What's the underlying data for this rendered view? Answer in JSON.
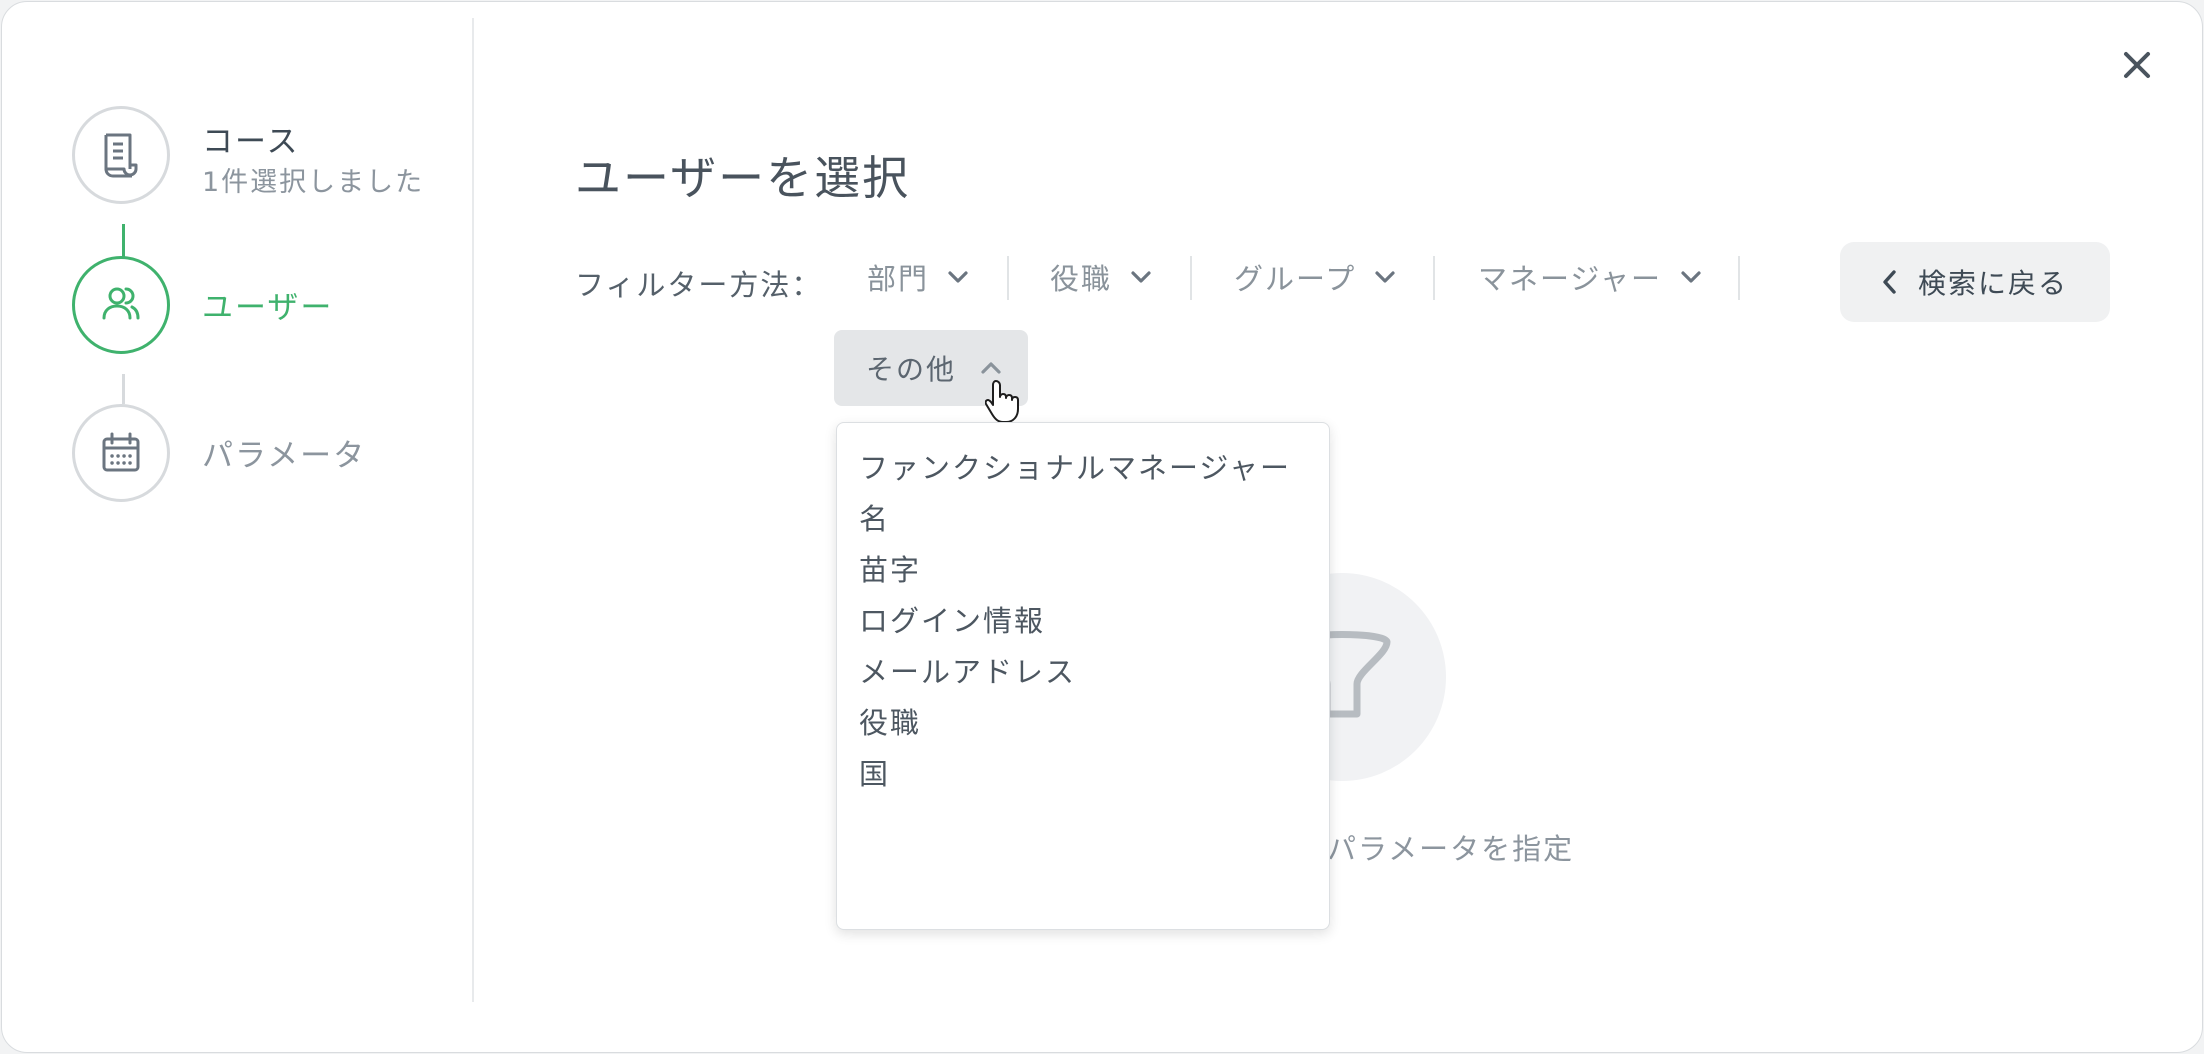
{
  "steps": [
    {
      "title": "コース",
      "subtitle": "1件選択しました",
      "icon": "document-icon",
      "state": "completed"
    },
    {
      "title": "ユーザー",
      "subtitle": "",
      "icon": "users-icon",
      "state": "active"
    },
    {
      "title": "パラメータ",
      "subtitle": "",
      "icon": "calendar-icon",
      "state": "pending"
    }
  ],
  "header": {
    "title": "ユーザーを選択"
  },
  "filters": {
    "label": "フィルター方法：",
    "items": [
      "部門",
      "役職",
      "グループ",
      "マネージャー"
    ],
    "other_label": "その他",
    "back_button": "検索に戻る"
  },
  "dropdown": {
    "items": [
      "ファンクショナルマネージャー",
      "名",
      "苗字",
      "ログイン情報",
      "メールアドレス",
      "役職",
      "国"
    ]
  },
  "empty_state": {
    "text": "パラメータを指定",
    "icon": "filter-funnel-icon"
  },
  "colors": {
    "accent": "#3fb26d",
    "text": "#3e4a55",
    "muted": "#8c959e",
    "border": "#d7dadd"
  }
}
